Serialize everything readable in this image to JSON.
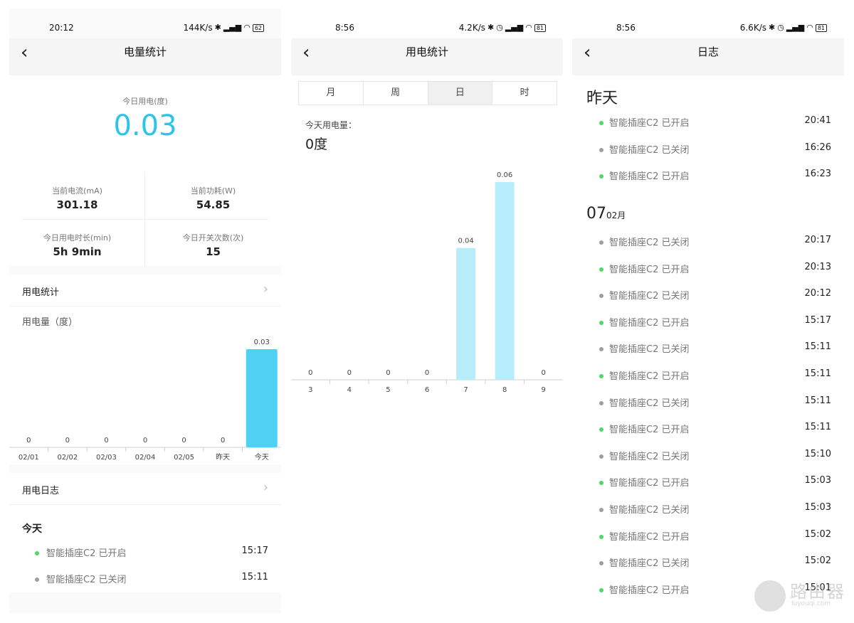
{
  "watermark": {
    "title": "路由器",
    "url": "luyouqi.com"
  },
  "panel1": {
    "status": {
      "time": "20:12",
      "speed": "144K/s",
      "battery": "62"
    },
    "nav": {
      "title": "电量统计"
    },
    "today": {
      "label": "今日用电(度)",
      "value": "0.03"
    },
    "stats": [
      {
        "label": "当前电流(mA)",
        "value": "301.18"
      },
      {
        "label": "当前功耗(W)",
        "value": "54.85"
      },
      {
        "label": "今日用电时长(min)",
        "value": "5h 9min"
      },
      {
        "label": "今日开关次数(次)",
        "value": "15"
      }
    ],
    "stats_section": {
      "title": "用电统计",
      "unit_label": "用电量（度）"
    },
    "log_section": {
      "title": "用电日志",
      "day": "今天",
      "entries": [
        {
          "text": "智能插座C2 已开启",
          "time": "15:17",
          "state": "on"
        },
        {
          "text": "智能插座C2 已关闭",
          "time": "15:11",
          "state": "off"
        }
      ]
    },
    "colors": {
      "accent": "#2cc4e8",
      "bar": "#4fd1f4",
      "on_dot": "#4cd964",
      "off_dot": "#9e9e9e"
    }
  },
  "panel2": {
    "status": {
      "time": "8:56",
      "speed": "4.2K/s",
      "battery": "81"
    },
    "nav": {
      "title": "用电统计"
    },
    "tabs": [
      {
        "label": "月",
        "active": false
      },
      {
        "label": "周",
        "active": false
      },
      {
        "label": "日",
        "active": true
      },
      {
        "label": "时",
        "active": false
      }
    ],
    "total": {
      "label": "今天用电量：",
      "value": "0度"
    },
    "colors": {
      "bar": "#b7ecfa"
    }
  },
  "panel3": {
    "status": {
      "time": "8:56",
      "speed": "6.6K/s",
      "battery": "81"
    },
    "nav": {
      "title": "日志"
    },
    "groups": [
      {
        "day": "昨天",
        "month": "",
        "entries": [
          {
            "text": "智能插座C2 已开启",
            "time": "20:41",
            "state": "on"
          },
          {
            "text": "智能插座C2 已关闭",
            "time": "16:26",
            "state": "off"
          },
          {
            "text": "智能插座C2 已开启",
            "time": "16:23",
            "state": "on"
          }
        ]
      },
      {
        "day": "07",
        "month": "02月",
        "entries": [
          {
            "text": "智能插座C2 已关闭",
            "time": "20:17",
            "state": "off"
          },
          {
            "text": "智能插座C2 已开启",
            "time": "20:13",
            "state": "on"
          },
          {
            "text": "智能插座C2 已关闭",
            "time": "20:12",
            "state": "off"
          },
          {
            "text": "智能插座C2 已开启",
            "time": "15:17",
            "state": "on"
          },
          {
            "text": "智能插座C2 已关闭",
            "time": "15:11",
            "state": "off"
          },
          {
            "text": "智能插座C2 已开启",
            "time": "15:11",
            "state": "on"
          },
          {
            "text": "智能插座C2 已关闭",
            "time": "15:11",
            "state": "off"
          },
          {
            "text": "智能插座C2 已开启",
            "time": "15:11",
            "state": "on"
          },
          {
            "text": "智能插座C2 已关闭",
            "time": "15:10",
            "state": "off"
          },
          {
            "text": "智能插座C2 已开启",
            "time": "15:03",
            "state": "on"
          },
          {
            "text": "智能插座C2 已关闭",
            "time": "15:03",
            "state": "off"
          },
          {
            "text": "智能插座C2 已开启",
            "time": "15:02",
            "state": "on"
          },
          {
            "text": "智能插座C2 已关闭",
            "time": "15:02",
            "state": "off"
          },
          {
            "text": "智能插座C2 已开启",
            "time": "15:01",
            "state": "on"
          }
        ]
      }
    ]
  },
  "chart_data": [
    {
      "type": "bar",
      "categories": [
        "02/01",
        "02/02",
        "02/03",
        "02/04",
        "02/05",
        "昨天",
        "今天"
      ],
      "values": [
        0,
        0,
        0,
        0,
        0,
        0,
        0.03
      ],
      "data_labels": [
        "0",
        "0",
        "0",
        "0",
        "0",
        "0",
        "0.03"
      ],
      "title": "",
      "xlabel": "",
      "ylabel": "用电量（度）",
      "ylim": [
        0,
        0.03
      ],
      "grid": false
    },
    {
      "type": "bar",
      "categories": [
        "3",
        "4",
        "5",
        "6",
        "7",
        "8",
        "9"
      ],
      "values": [
        0,
        0,
        0,
        0,
        0.04,
        0.06,
        0
      ],
      "data_labels": [
        "0",
        "0",
        "0",
        "0",
        "0.04",
        "0.06",
        "0"
      ],
      "title": "",
      "xlabel": "",
      "ylabel": "",
      "ylim": [
        0,
        0.06
      ],
      "grid": false
    }
  ]
}
